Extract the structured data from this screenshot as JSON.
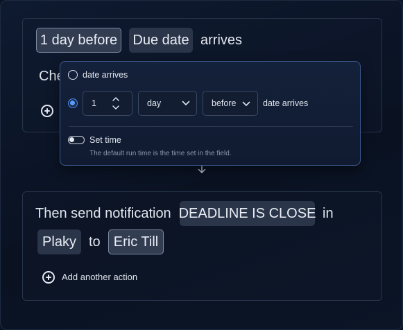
{
  "trigger": {
    "chip_offset": "1 day before",
    "chip_field": "Due date",
    "suffix": "arrives",
    "hidden_text": "Che"
  },
  "popup": {
    "option1_label": "date arrives",
    "number_value": "1",
    "unit_value": "day",
    "direction_value": "before",
    "option2_suffix": "date arrives",
    "set_time_label": "Set time",
    "hint": "The default run time is the time set in the field."
  },
  "action": {
    "prefix": "Then send notification",
    "message_chip": "DEADLINE IS CLOSE",
    "in_word": "in",
    "app_chip": "Plaky",
    "to_word": "to",
    "user_chip": "Eric Till",
    "add_action_label": "Add another action"
  },
  "colors": {
    "background": "#0b1424",
    "chip": "#2a3549",
    "accent": "#4b8bf4",
    "popup_border": "#3b5a8e"
  }
}
